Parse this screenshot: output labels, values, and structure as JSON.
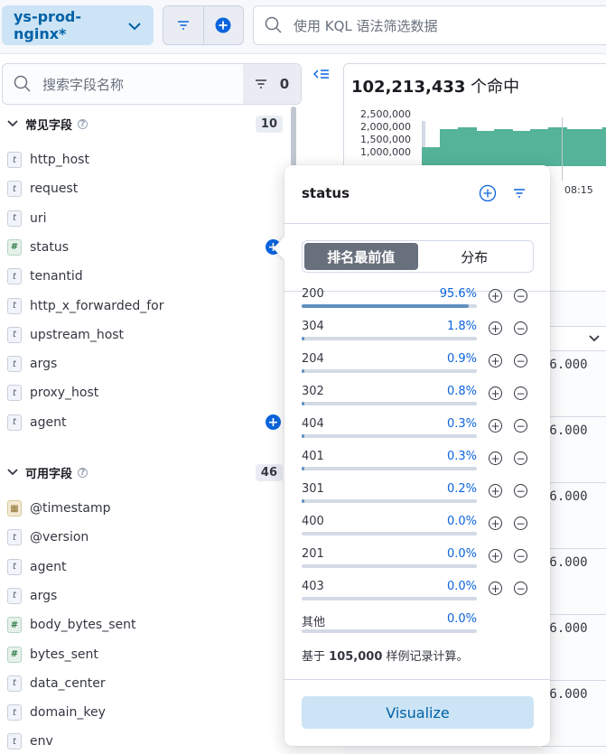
{
  "topbar": {
    "index_pattern": "ys-prod-nginx*",
    "kql_placeholder": "使用 KQL 语法筛选数据"
  },
  "sidebar": {
    "search_placeholder": "搜索字段名称",
    "filter_count": "0",
    "selected_group": {
      "title": "常见字段",
      "count": "10",
      "fields": [
        {
          "name": "http_host",
          "type": "t"
        },
        {
          "name": "request",
          "type": "t"
        },
        {
          "name": "uri",
          "type": "t"
        },
        {
          "name": "status",
          "type": "#"
        },
        {
          "name": "tenantid",
          "type": "t"
        },
        {
          "name": "http_x_forwarded_for",
          "type": "t"
        },
        {
          "name": "upstream_host",
          "type": "t"
        },
        {
          "name": "args",
          "type": "t"
        },
        {
          "name": "proxy_host",
          "type": "t"
        },
        {
          "name": "agent",
          "type": "t"
        }
      ]
    },
    "available_group": {
      "title": "可用字段",
      "count": "46",
      "fields": [
        {
          "name": "@timestamp",
          "type": "date"
        },
        {
          "name": "@version",
          "type": "t"
        },
        {
          "name": "agent",
          "type": "t"
        },
        {
          "name": "args",
          "type": "t"
        },
        {
          "name": "body_bytes_sent",
          "type": "#"
        },
        {
          "name": "bytes_sent",
          "type": "#"
        },
        {
          "name": "data_center",
          "type": "t"
        },
        {
          "name": "domain_key",
          "type": "t"
        },
        {
          "name": "env",
          "type": "t"
        }
      ]
    }
  },
  "main": {
    "hits_count": "102,213,433",
    "hits_suffix": "个命中",
    "chart_data": {
      "type": "bar",
      "yticks": [
        "2,500,000",
        "2,000,000",
        "1,500,000",
        "1,000,000"
      ],
      "xtick": "08:15",
      "values": [
        1000000,
        1900000,
        2000000,
        1800000,
        1900000,
        1800000,
        1900000,
        2000000,
        1900000,
        1900000,
        2000000
      ],
      "ylim": [
        0,
        2700000
      ]
    },
    "row_values": [
      "16.000",
      "16.000",
      "16.000",
      "16.000",
      "16.000",
      "16.000"
    ]
  },
  "popover": {
    "title": "status",
    "tabs": [
      "排名最前值",
      "分布"
    ],
    "active_tab": 0,
    "values": [
      {
        "label": "200",
        "pct": "95.6%",
        "frac": 0.956,
        "actions": true
      },
      {
        "label": "304",
        "pct": "1.8%",
        "frac": 0.018,
        "actions": true
      },
      {
        "label": "204",
        "pct": "0.9%",
        "frac": 0.009,
        "actions": true
      },
      {
        "label": "302",
        "pct": "0.8%",
        "frac": 0.008,
        "actions": true
      },
      {
        "label": "404",
        "pct": "0.3%",
        "frac": 0.003,
        "actions": true
      },
      {
        "label": "401",
        "pct": "0.3%",
        "frac": 0.003,
        "actions": true
      },
      {
        "label": "301",
        "pct": "0.2%",
        "frac": 0.002,
        "actions": true
      },
      {
        "label": "400",
        "pct": "0.0%",
        "frac": 0.0,
        "actions": true
      },
      {
        "label": "201",
        "pct": "0.0%",
        "frac": 0.0,
        "actions": true
      },
      {
        "label": "403",
        "pct": "0.0%",
        "frac": 0.0,
        "actions": true
      },
      {
        "label": "其他",
        "pct": "0.0%",
        "frac": 0.0,
        "actions": false
      }
    ],
    "sample_prefix": "基于",
    "sample_count": "105,000",
    "sample_suffix": "样例记录计算。",
    "visualize_label": "Visualize"
  },
  "colors": {
    "accent": "#0b64dd",
    "bar": "#54b399",
    "value_bar": "#6092c0",
    "index_pill_bg": "#cce4f5"
  }
}
